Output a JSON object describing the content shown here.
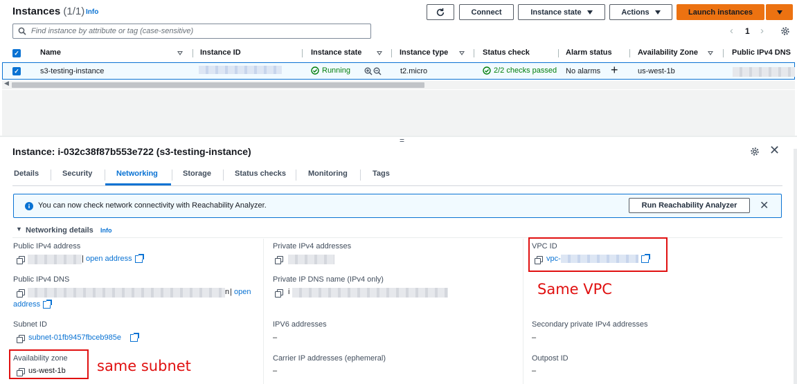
{
  "header": {
    "title": "Instances",
    "count": "(1/1)",
    "info": "Info",
    "connect": "Connect",
    "instance_state": "Instance state",
    "actions": "Actions",
    "launch": "Launch instances"
  },
  "search": {
    "placeholder": "Find instance by attribute or tag (case-sensitive)"
  },
  "pagination": {
    "page": "1"
  },
  "table": {
    "columns": [
      "Name",
      "Instance ID",
      "Instance state",
      "Instance type",
      "Status check",
      "Alarm status",
      "Availability Zone",
      "Public IPv4 DNS"
    ],
    "row": {
      "name": "s3-testing-instance",
      "state": "Running",
      "type": "t2.micro",
      "status": "2/2 checks passed",
      "alarm": "No alarms",
      "az": "us-west-1b"
    }
  },
  "details": {
    "title": "Instance: i-032c38f87b553e722 (s3-testing-instance)",
    "tabs": [
      "Details",
      "Security",
      "Networking",
      "Storage",
      "Status checks",
      "Monitoring",
      "Tags"
    ],
    "active_tab": "Networking",
    "alert": "You can now check network connectivity with Reachability Analyzer.",
    "alert_button": "Run Reachability Analyzer",
    "section_title": "Networking details",
    "section_info": "Info",
    "fields": {
      "public_ipv4_address": "Public IPv4 address",
      "open_address": "open address",
      "private_ipv4_addresses": "Private IPv4 addresses",
      "vpc_id": "VPC ID",
      "vpc_prefix": "vpc-",
      "public_ipv4_dns": "Public IPv4 DNS",
      "open": "open",
      "address": "address",
      "private_ip_dns": "Private IP DNS name (IPv4 only)",
      "subnet_id": "Subnet ID",
      "subnet_value": "subnet-01fb9457fbceb985e",
      "ipv6": "IPV6 addresses",
      "secondary_private": "Secondary private IPv4 addresses",
      "availability_zone": "Availability zone",
      "az_value": "us-west-1b",
      "carrier_ip": "Carrier IP addresses (ephemeral)",
      "outpost_id": "Outpost ID",
      "dash": "–",
      "dns_tail": "n",
      "private_dns_head": "i"
    }
  },
  "annotations": {
    "same_vpc": "Same VPC",
    "same_subnet": "same subnet"
  },
  "colors": {
    "accent": "#0972d3",
    "launch": "#ec7211",
    "success": "#037f0c",
    "annotation": "#e01010"
  }
}
